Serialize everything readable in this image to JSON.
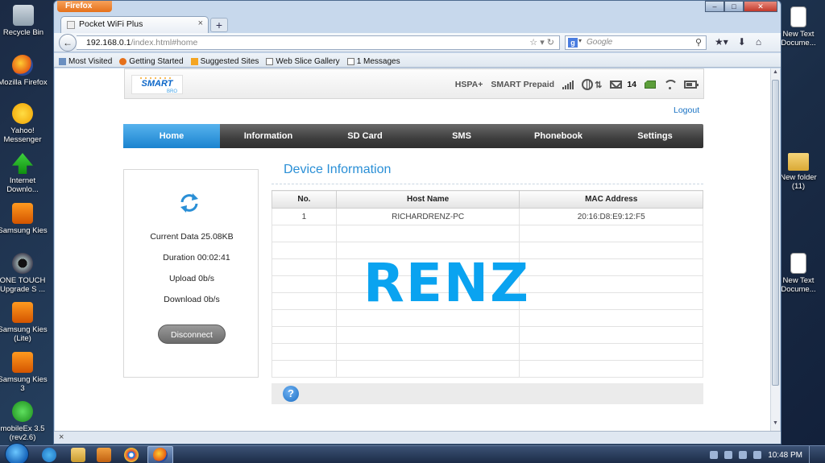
{
  "desktop": {
    "left_icons": [
      {
        "label": "Recycle Bin"
      },
      {
        "label": "Mozilla Firefox"
      },
      {
        "label": "Yahoo! Messenger"
      },
      {
        "label": "Internet Downlo..."
      },
      {
        "label": "Samsung Kies"
      },
      {
        "label": "ONE TOUCH Upgrade S ..."
      },
      {
        "label": "Samsung Kies (Lite)"
      },
      {
        "label": "Samsung Kies 3"
      },
      {
        "label": "mobileEx 3.5 (rev2.6)"
      }
    ],
    "right_icons": [
      {
        "label": "New Text Docume..."
      },
      {
        "label": "New folder (11)"
      },
      {
        "label": "New Text Docume..."
      }
    ]
  },
  "browser": {
    "app_button": "Firefox",
    "tab_title": "Pocket WiFi Plus",
    "url_host": "192.168.0.1",
    "url_path": "/index.html#home",
    "search_placeholder": "Google",
    "bookmarks": [
      "Most Visited",
      "Getting Started",
      "Suggested Sites",
      "Web Slice Gallery",
      "1 Messages"
    ]
  },
  "router": {
    "logo_text": "SMART",
    "logo_sub": "BRO",
    "network_type": "HSPA+",
    "carrier": "SMART Prepaid",
    "sms_count": "14",
    "logout": "Logout",
    "nav": [
      "Home",
      "Information",
      "SD Card",
      "SMS",
      "Phonebook",
      "Settings"
    ],
    "active_nav": "Home",
    "connection": {
      "current_data": "Current Data 25.08KB",
      "duration": "Duration 00:02:41",
      "upload": "Upload 0b/s",
      "download": "Download 0b/s",
      "disconnect": "Disconnect"
    },
    "device_info": {
      "title": "Device Information",
      "columns": [
        "No.",
        "Host Name",
        "MAC Address"
      ],
      "rows": [
        [
          "1",
          "RICHARDRENZ-PC",
          "20:16:D8:E9:12:F5"
        ]
      ]
    },
    "help_symbol": "?"
  },
  "watermark": "RENZ",
  "taskbar": {
    "clock": "10:48 PM"
  }
}
